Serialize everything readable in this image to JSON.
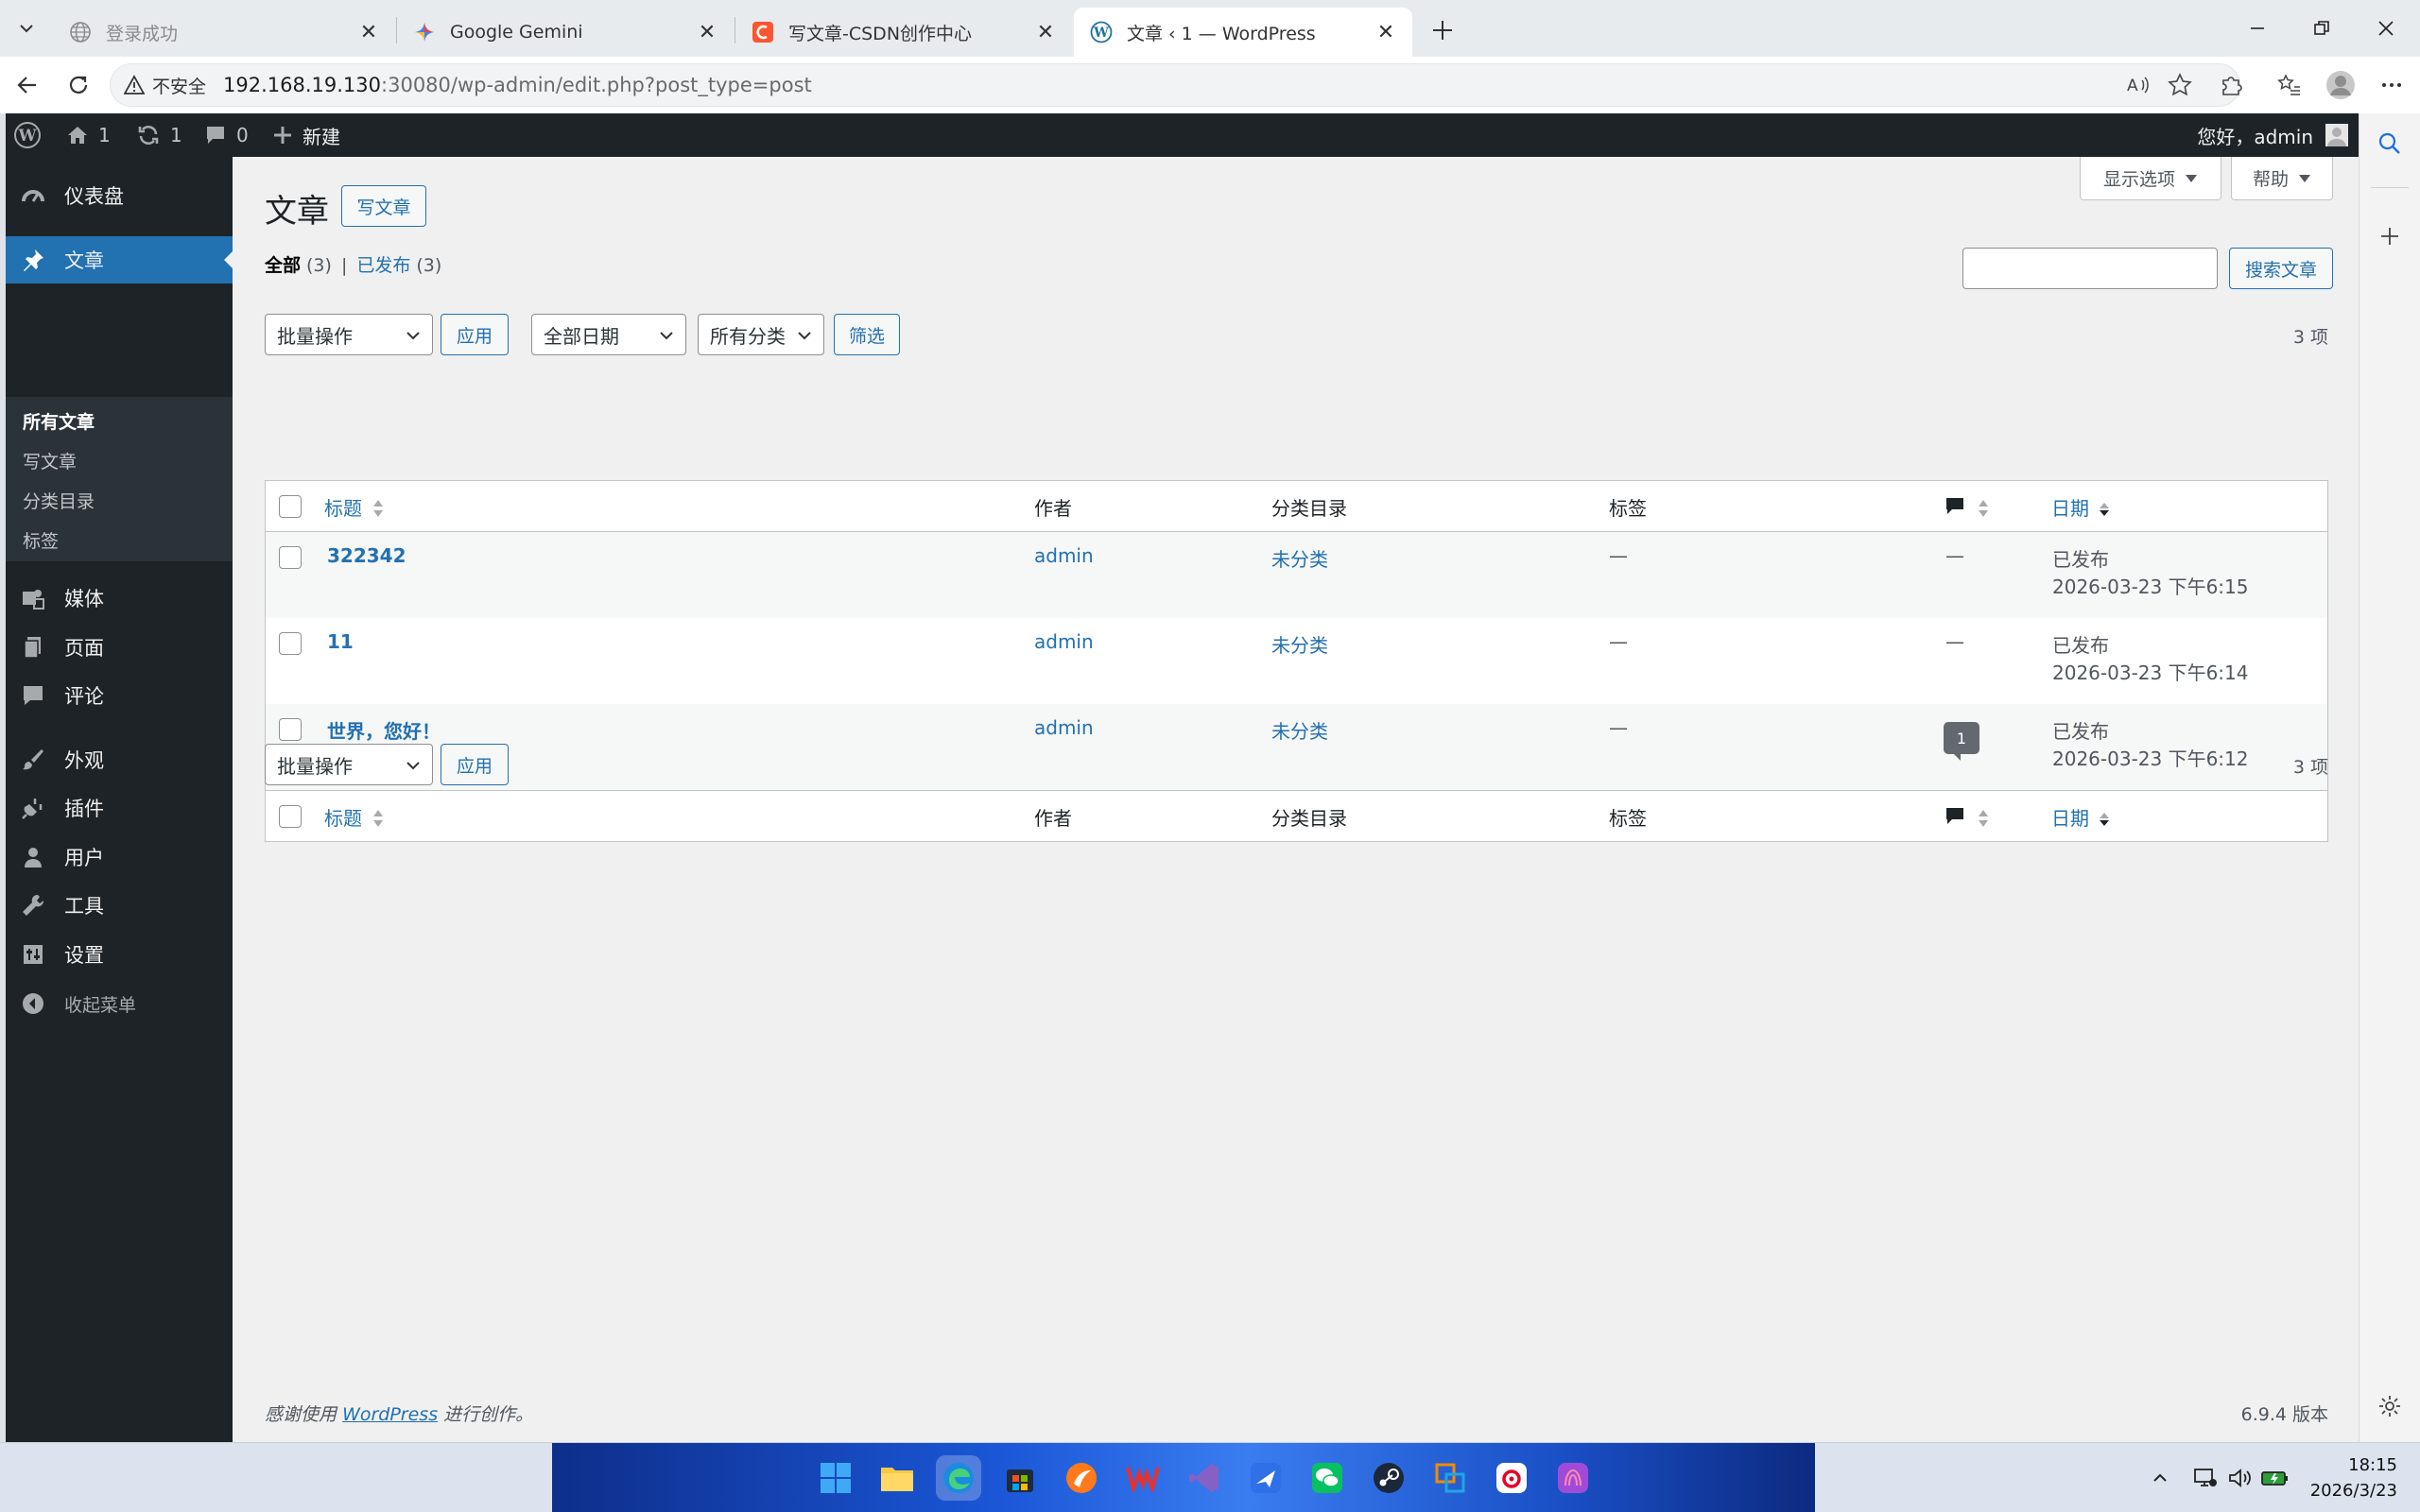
{
  "browser": {
    "tabs": [
      {
        "title": "登录成功",
        "active": false
      },
      {
        "title": "Google Gemini",
        "active": false
      },
      {
        "title": "写文章-CSDN创作中心",
        "active": false
      },
      {
        "title": "文章 ‹ 1 — WordPress",
        "active": true
      }
    ],
    "security_label": "不安全",
    "url_host": "192.168.19.130",
    "url_path": ":30080/wp-admin/edit.php?post_type=post"
  },
  "adminbar": {
    "home_count": "1",
    "updates_count": "1",
    "comments_count": "0",
    "new_label": "新建",
    "greeting": "您好，admin"
  },
  "sidebar": {
    "dashboard": "仪表盘",
    "posts": "文章",
    "sub": {
      "all_posts": "所有文章",
      "add_new": "写文章",
      "categories": "分类目录",
      "tags": "标签"
    },
    "media": "媒体",
    "pages": "页面",
    "comments": "评论",
    "appearance": "外观",
    "plugins": "插件",
    "users": "用户",
    "tools": "工具",
    "settings": "设置",
    "collapse": "收起菜单"
  },
  "page": {
    "title": "文章",
    "add_new": "写文章",
    "screen_options": "显示选项",
    "help": "帮助",
    "filter_all": "全部",
    "filter_all_count": "(3)",
    "filter_published": "已发布",
    "filter_published_count": "(3)",
    "search_button": "搜索文章",
    "search_value": "",
    "bulk_action": "批量操作",
    "apply": "应用",
    "date_filter": "全部日期",
    "category_filter": "所有分类",
    "filter_button": "筛选",
    "item_count": "3 项"
  },
  "table": {
    "columns": {
      "title": "标题",
      "author": "作者",
      "categories": "分类目录",
      "tags": "标签",
      "date": "日期"
    },
    "rows": [
      {
        "title": "322342",
        "author": "admin",
        "category": "未分类",
        "tags": "—",
        "comments": "—",
        "status": "已发布",
        "date": "2026-03-23 下午6:15"
      },
      {
        "title": "11",
        "author": "admin",
        "category": "未分类",
        "tags": "—",
        "comments": "—",
        "status": "已发布",
        "date": "2026-03-23 下午6:14"
      },
      {
        "title": "世界，您好！",
        "author": "admin",
        "category": "未分类",
        "tags": "—",
        "comments": "1",
        "status": "已发布",
        "date": "2026-03-23 下午6:12"
      }
    ]
  },
  "footer": {
    "thanks_prefix": "感谢使用",
    "wordpress_link": "WordPress",
    "thanks_suffix": "进行创作。",
    "version": "6.9.4 版本"
  },
  "taskbar": {
    "time": "18:15",
    "date": "2026/3/23"
  },
  "colors": {
    "wp_admin_dark": "#1d2327",
    "wp_blue": "#2271b1",
    "content_bg": "#f0f0f1"
  }
}
